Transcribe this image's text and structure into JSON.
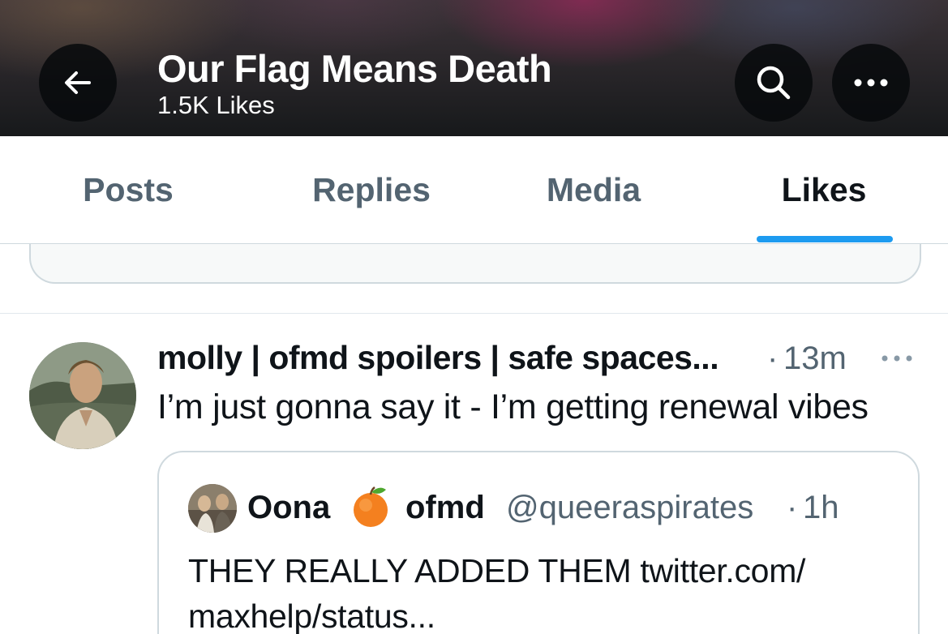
{
  "header": {
    "title": "Our Flag Means Death",
    "subtitle": "1.5K Likes"
  },
  "tabs": [
    {
      "label": "Posts",
      "active": false
    },
    {
      "label": "Replies",
      "active": false
    },
    {
      "label": "Media",
      "active": false
    },
    {
      "label": "Likes",
      "active": true
    }
  ],
  "tweet": {
    "display_name": "molly | ofmd spoilers | safe spaces...",
    "dot": "·",
    "time": "13m",
    "text": "I’m just gonna say it - I’m getting renewal vibes",
    "quote": {
      "name_part1": "Oona",
      "name_part2": "ofmd",
      "handle": "@queeraspirates",
      "dot": "·",
      "time": "1h",
      "text": "THEY REALLY ADDED THEM twitter.com/\nmaxhelp/status..."
    }
  },
  "colors": {
    "accent": "#1d9bf0",
    "secondary_text": "#536471",
    "primary_text": "#0f1419",
    "border": "#cfd9de"
  },
  "icons": {
    "back": "arrow-left-icon",
    "search": "search-icon",
    "more": "more-horizontal-icon",
    "emoji": "orange-emoji-icon"
  }
}
